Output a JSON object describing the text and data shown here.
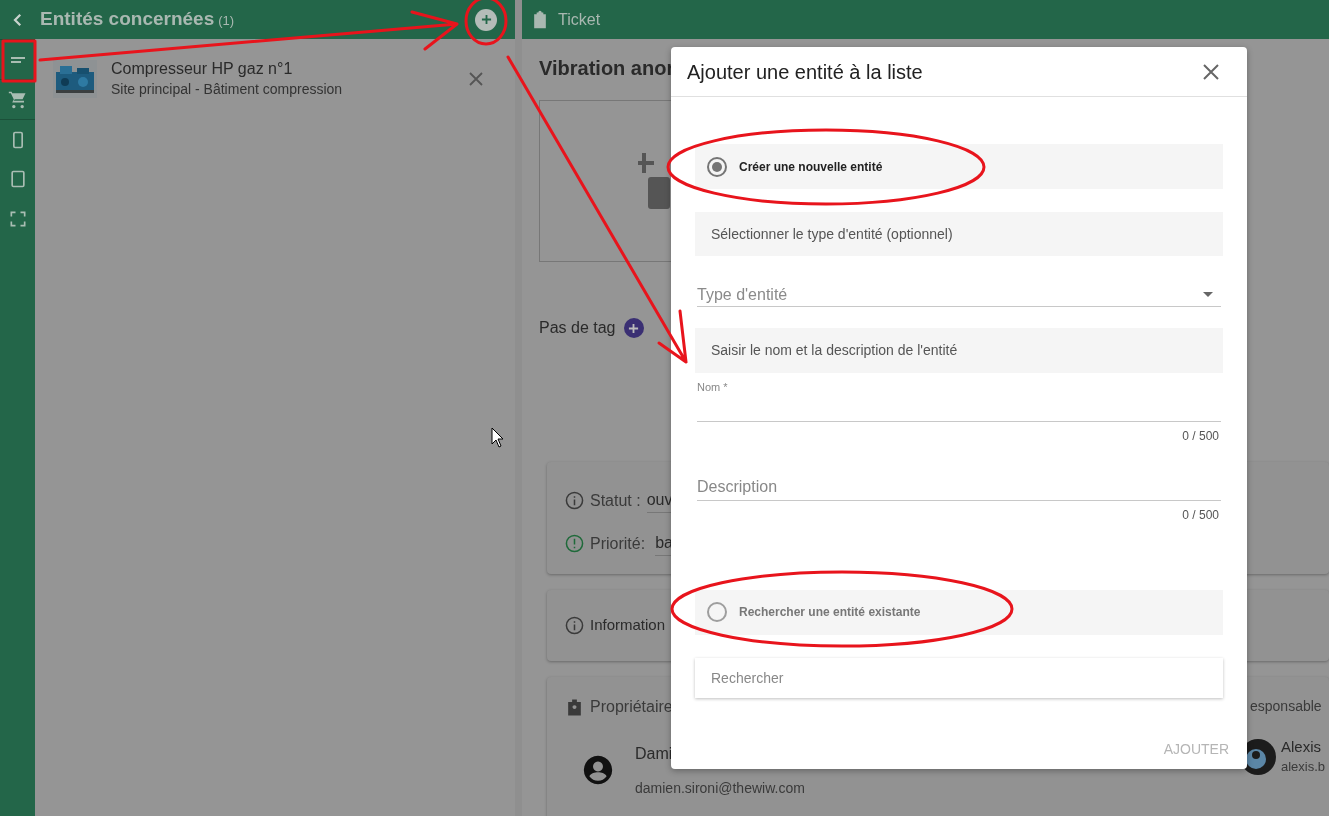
{
  "left_panel": {
    "title": "Entités concernées",
    "count": "(1)",
    "items": [
      {
        "name": "Compresseur HP gaz n°1",
        "location": "Site principal - Bâtiment compression"
      }
    ]
  },
  "ticket": {
    "header": "Ticket",
    "title": "Vibration anor",
    "tags_label": "Pas de tag",
    "status_label": "Statut :",
    "status_value": "ouv",
    "priority_label": "Priorité:",
    "priority_value": "ba",
    "info_label": "Information",
    "owner_label": "Propriétaire",
    "owner_name": "Dami",
    "owner_email": "damien.sironi@thewiw.com",
    "responsible_label": "esponsable",
    "responsible_name": "Alexis",
    "responsible_email": "alexis.b"
  },
  "dialog": {
    "title": "Ajouter une entité à la liste",
    "options": [
      {
        "label": "Créer une nouvelle entité",
        "selected": true
      },
      {
        "label": "Rechercher une entité existante",
        "selected": false
      }
    ],
    "type_section": "Sélectionner le type d'entité (optionnel)",
    "type_select": {
      "placeholder": "Type d'entité"
    },
    "name_section": "Saisir le nom et la description de l'entité",
    "name_field": {
      "label": "Nom *",
      "counter": "0 / 500"
    },
    "description_field": {
      "placeholder": "Description",
      "counter": "0 / 500"
    },
    "search": {
      "placeholder": "Rechercher"
    },
    "submit": {
      "label": "AJOUTER",
      "disabled": true
    }
  }
}
